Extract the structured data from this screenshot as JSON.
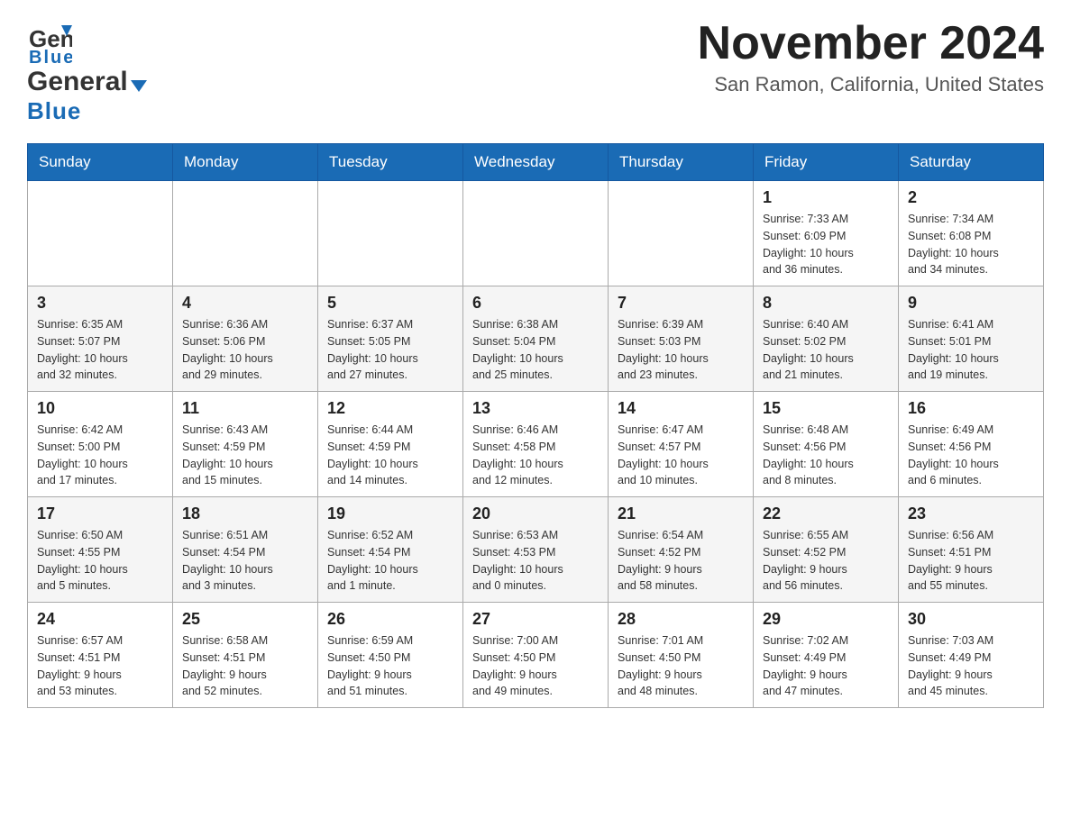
{
  "header": {
    "logo_line1": "General",
    "logo_line2": "Blue",
    "calendar_title": "November 2024",
    "calendar_subtitle": "San Ramon, California, United States"
  },
  "weekdays": [
    "Sunday",
    "Monday",
    "Tuesday",
    "Wednesday",
    "Thursday",
    "Friday",
    "Saturday"
  ],
  "weeks": [
    [
      {
        "day": "",
        "info": ""
      },
      {
        "day": "",
        "info": ""
      },
      {
        "day": "",
        "info": ""
      },
      {
        "day": "",
        "info": ""
      },
      {
        "day": "",
        "info": ""
      },
      {
        "day": "1",
        "info": "Sunrise: 7:33 AM\nSunset: 6:09 PM\nDaylight: 10 hours\nand 36 minutes."
      },
      {
        "day": "2",
        "info": "Sunrise: 7:34 AM\nSunset: 6:08 PM\nDaylight: 10 hours\nand 34 minutes."
      }
    ],
    [
      {
        "day": "3",
        "info": "Sunrise: 6:35 AM\nSunset: 5:07 PM\nDaylight: 10 hours\nand 32 minutes."
      },
      {
        "day": "4",
        "info": "Sunrise: 6:36 AM\nSunset: 5:06 PM\nDaylight: 10 hours\nand 29 minutes."
      },
      {
        "day": "5",
        "info": "Sunrise: 6:37 AM\nSunset: 5:05 PM\nDaylight: 10 hours\nand 27 minutes."
      },
      {
        "day": "6",
        "info": "Sunrise: 6:38 AM\nSunset: 5:04 PM\nDaylight: 10 hours\nand 25 minutes."
      },
      {
        "day": "7",
        "info": "Sunrise: 6:39 AM\nSunset: 5:03 PM\nDaylight: 10 hours\nand 23 minutes."
      },
      {
        "day": "8",
        "info": "Sunrise: 6:40 AM\nSunset: 5:02 PM\nDaylight: 10 hours\nand 21 minutes."
      },
      {
        "day": "9",
        "info": "Sunrise: 6:41 AM\nSunset: 5:01 PM\nDaylight: 10 hours\nand 19 minutes."
      }
    ],
    [
      {
        "day": "10",
        "info": "Sunrise: 6:42 AM\nSunset: 5:00 PM\nDaylight: 10 hours\nand 17 minutes."
      },
      {
        "day": "11",
        "info": "Sunrise: 6:43 AM\nSunset: 4:59 PM\nDaylight: 10 hours\nand 15 minutes."
      },
      {
        "day": "12",
        "info": "Sunrise: 6:44 AM\nSunset: 4:59 PM\nDaylight: 10 hours\nand 14 minutes."
      },
      {
        "day": "13",
        "info": "Sunrise: 6:46 AM\nSunset: 4:58 PM\nDaylight: 10 hours\nand 12 minutes."
      },
      {
        "day": "14",
        "info": "Sunrise: 6:47 AM\nSunset: 4:57 PM\nDaylight: 10 hours\nand 10 minutes."
      },
      {
        "day": "15",
        "info": "Sunrise: 6:48 AM\nSunset: 4:56 PM\nDaylight: 10 hours\nand 8 minutes."
      },
      {
        "day": "16",
        "info": "Sunrise: 6:49 AM\nSunset: 4:56 PM\nDaylight: 10 hours\nand 6 minutes."
      }
    ],
    [
      {
        "day": "17",
        "info": "Sunrise: 6:50 AM\nSunset: 4:55 PM\nDaylight: 10 hours\nand 5 minutes."
      },
      {
        "day": "18",
        "info": "Sunrise: 6:51 AM\nSunset: 4:54 PM\nDaylight: 10 hours\nand 3 minutes."
      },
      {
        "day": "19",
        "info": "Sunrise: 6:52 AM\nSunset: 4:54 PM\nDaylight: 10 hours\nand 1 minute."
      },
      {
        "day": "20",
        "info": "Sunrise: 6:53 AM\nSunset: 4:53 PM\nDaylight: 10 hours\nand 0 minutes."
      },
      {
        "day": "21",
        "info": "Sunrise: 6:54 AM\nSunset: 4:52 PM\nDaylight: 9 hours\nand 58 minutes."
      },
      {
        "day": "22",
        "info": "Sunrise: 6:55 AM\nSunset: 4:52 PM\nDaylight: 9 hours\nand 56 minutes."
      },
      {
        "day": "23",
        "info": "Sunrise: 6:56 AM\nSunset: 4:51 PM\nDaylight: 9 hours\nand 55 minutes."
      }
    ],
    [
      {
        "day": "24",
        "info": "Sunrise: 6:57 AM\nSunset: 4:51 PM\nDaylight: 9 hours\nand 53 minutes."
      },
      {
        "day": "25",
        "info": "Sunrise: 6:58 AM\nSunset: 4:51 PM\nDaylight: 9 hours\nand 52 minutes."
      },
      {
        "day": "26",
        "info": "Sunrise: 6:59 AM\nSunset: 4:50 PM\nDaylight: 9 hours\nand 51 minutes."
      },
      {
        "day": "27",
        "info": "Sunrise: 7:00 AM\nSunset: 4:50 PM\nDaylight: 9 hours\nand 49 minutes."
      },
      {
        "day": "28",
        "info": "Sunrise: 7:01 AM\nSunset: 4:50 PM\nDaylight: 9 hours\nand 48 minutes."
      },
      {
        "day": "29",
        "info": "Sunrise: 7:02 AM\nSunset: 4:49 PM\nDaylight: 9 hours\nand 47 minutes."
      },
      {
        "day": "30",
        "info": "Sunrise: 7:03 AM\nSunset: 4:49 PM\nDaylight: 9 hours\nand 45 minutes."
      }
    ]
  ]
}
